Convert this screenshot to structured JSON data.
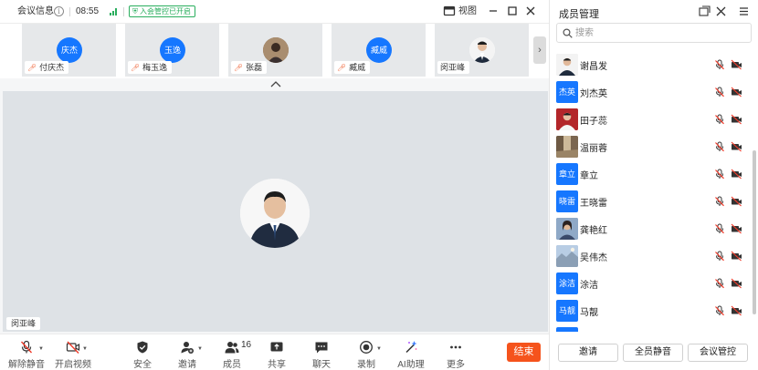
{
  "titlebar": {
    "meeting_info": "会议信息",
    "time": "08:55",
    "waiting_room_badge": "入会管控已开启",
    "view_label": "视图"
  },
  "thumbnails": [
    {
      "name": "付庆杰",
      "avatar_text": "庆杰",
      "avatar_type": "initials",
      "muted": true
    },
    {
      "name": "梅玉逸",
      "avatar_text": "玉逸",
      "avatar_type": "initials",
      "muted": true
    },
    {
      "name": "张磊",
      "avatar_text": "",
      "avatar_type": "photo",
      "muted": true
    },
    {
      "name": "臧威",
      "avatar_text": "臧威",
      "avatar_type": "initials",
      "muted": true
    },
    {
      "name": "闵亚峰",
      "avatar_text": "",
      "avatar_type": "photo",
      "muted": false
    }
  ],
  "stage": {
    "speaker_name": "闵亚峰"
  },
  "toolbar": {
    "unmute": "解除静音",
    "start_video": "开启视频",
    "security": "安全",
    "invite": "邀请",
    "members": "成员",
    "member_count": "16",
    "share": "共享",
    "chat": "聊天",
    "record": "录制",
    "ai_assistant": "AI助理",
    "more": "更多",
    "end": "结束"
  },
  "panel": {
    "title": "成员管理",
    "search_placeholder": "搜索",
    "members": [
      {
        "name": "谢昌发",
        "avatar_text": "",
        "avatar_type": "photo"
      },
      {
        "name": "刘杰英",
        "avatar_text": "杰英",
        "avatar_type": "initials"
      },
      {
        "name": "田子蕊",
        "avatar_text": "",
        "avatar_type": "photo"
      },
      {
        "name": "温丽蓉",
        "avatar_text": "",
        "avatar_type": "photo"
      },
      {
        "name": "章立",
        "avatar_text": "章立",
        "avatar_type": "initials"
      },
      {
        "name": "王晓雷",
        "avatar_text": "晓雷",
        "avatar_type": "initials"
      },
      {
        "name": "龚艳红",
        "avatar_text": "",
        "avatar_type": "photo"
      },
      {
        "name": "吴伟杰",
        "avatar_text": "",
        "avatar_type": "photo"
      },
      {
        "name": "涂洁",
        "avatar_text": "涂洁",
        "avatar_type": "initials"
      },
      {
        "name": "马靓",
        "avatar_text": "马靓",
        "avatar_type": "initials"
      },
      {
        "name": "",
        "avatar_text": "",
        "avatar_type": "initials"
      }
    ],
    "invite_button": "邀请",
    "mute_all_button": "全员静音",
    "meeting_control_button": "会议管控"
  },
  "colors": {
    "accent_blue": "#1677ff",
    "end_button": "#f5531c",
    "muted_red": "#ee5a2a",
    "status_green": "#2aae5e"
  },
  "icons": {
    "info": "info-icon",
    "signal": "signal-icon",
    "shield": "shield-icon",
    "view": "view-icon",
    "minimize": "minimize-icon",
    "maximize": "maximize-icon",
    "close": "close-icon",
    "mic_off": "mic-off-icon",
    "camera_off": "camera-off-icon",
    "security": "shield-check-icon",
    "invite": "add-user-icon",
    "members": "members-icon",
    "share": "share-screen-icon",
    "chat": "chat-icon",
    "record": "record-icon",
    "ai": "ai-sparkle-icon",
    "more": "more-dots-icon",
    "search": "search-icon",
    "popout": "popout-icon",
    "menu": "menu-icon"
  }
}
